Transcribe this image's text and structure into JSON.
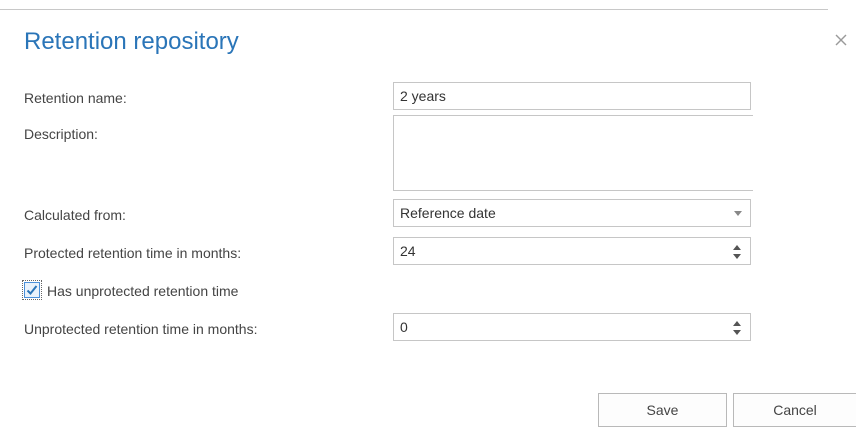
{
  "dialog": {
    "title": "Retention repository"
  },
  "form": {
    "retention_name_label": "Retention name:",
    "retention_name_value": "2 years",
    "description_label": "Description:",
    "description_value": "",
    "calculated_from_label": "Calculated from:",
    "calculated_from_value": "Reference date",
    "protected_label": "Protected retention time in months:",
    "protected_value": "24",
    "has_unprotected_label": "Has unprotected retention time",
    "has_unprotected_checked": true,
    "unprotected_label": "Unprotected retention time in months:",
    "unprotected_value": "0"
  },
  "buttons": {
    "save": "Save",
    "cancel": "Cancel"
  },
  "colors": {
    "title": "#2a75b8",
    "checkbox_accent": "#2a75b8"
  },
  "icons": {
    "close": "close-icon",
    "checkmark": "checkmark-icon",
    "dropdown": "chevron-down-icon",
    "spinner_up": "spinner-up-icon",
    "spinner_down": "spinner-down-icon"
  }
}
